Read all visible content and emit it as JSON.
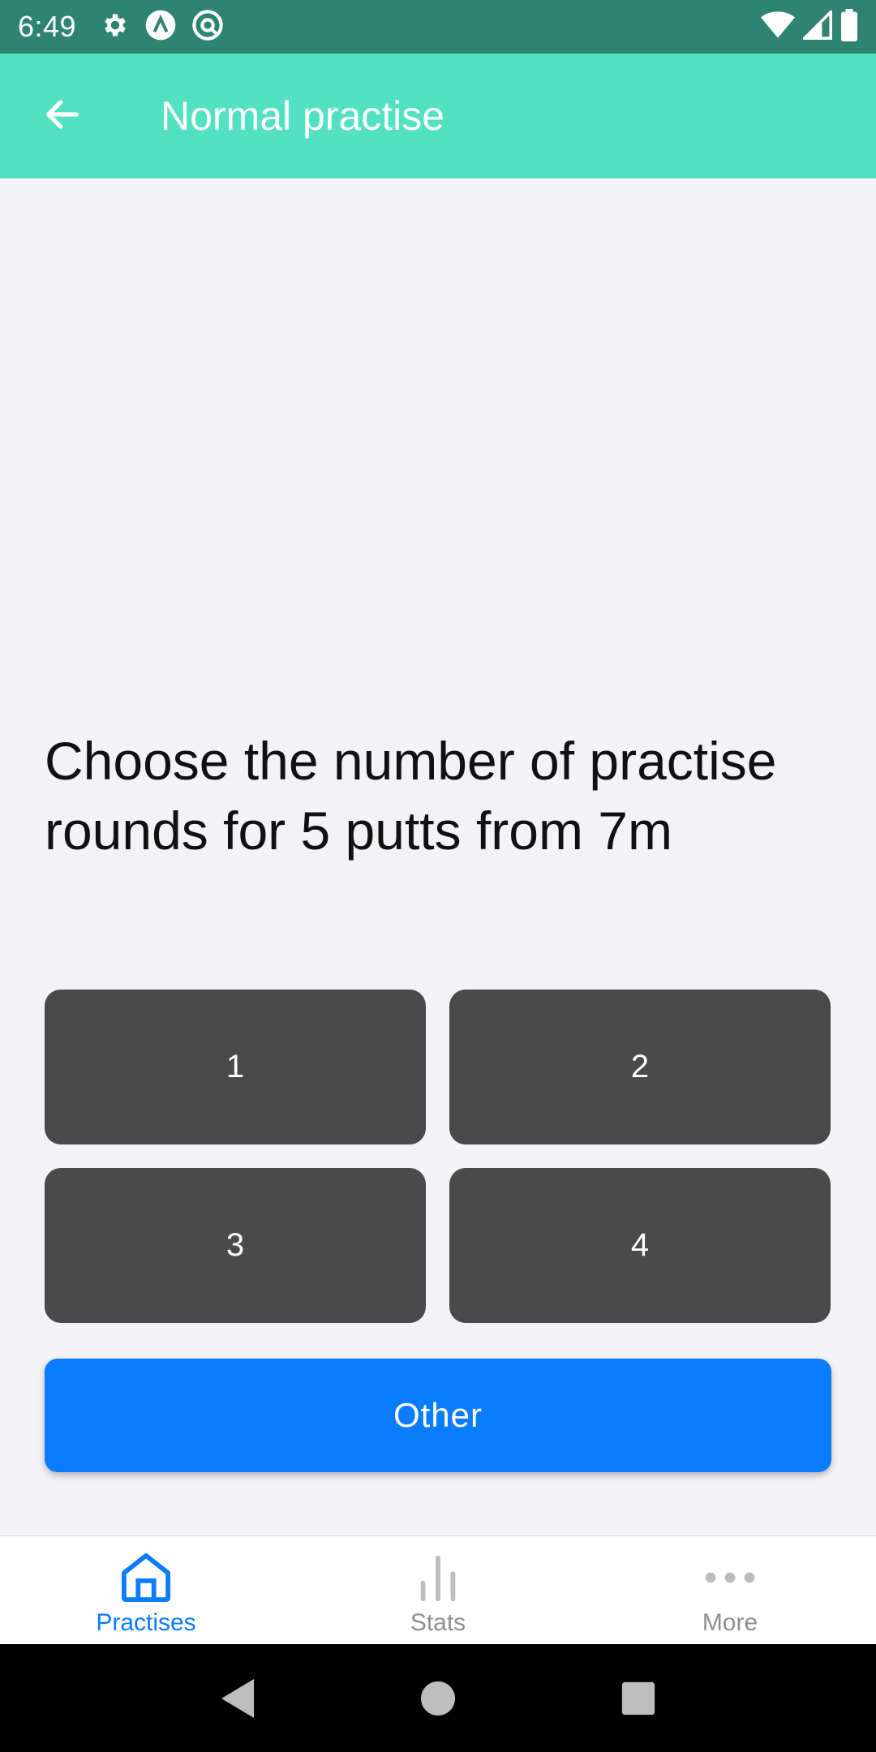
{
  "status_bar": {
    "time": "6:49",
    "left_icons": [
      "gear-icon",
      "a-circle-icon",
      "at-circle-icon"
    ],
    "right_icons": [
      "wifi-icon",
      "signal-icon",
      "battery-icon"
    ]
  },
  "app_bar": {
    "title": "Normal practise",
    "back_icon": "arrow-left-icon"
  },
  "main": {
    "prompt": "Choose the number of practise rounds for 5 putts from 7m",
    "choices": [
      {
        "label": "1"
      },
      {
        "label": "2"
      },
      {
        "label": "3"
      },
      {
        "label": "4"
      }
    ],
    "other_label": "Other"
  },
  "bottom_nav": {
    "items": [
      {
        "label": "Practises",
        "icon": "home-icon",
        "active": true
      },
      {
        "label": "Stats",
        "icon": "bar-chart-icon",
        "active": false
      },
      {
        "label": "More",
        "icon": "more-dots-icon",
        "active": false
      }
    ]
  },
  "colors": {
    "status_bar": "#2f8471",
    "app_bar": "#52e2c2",
    "choice_button": "#4a4a4a",
    "primary": "#0a7cff",
    "background": "#f2f2f7"
  }
}
